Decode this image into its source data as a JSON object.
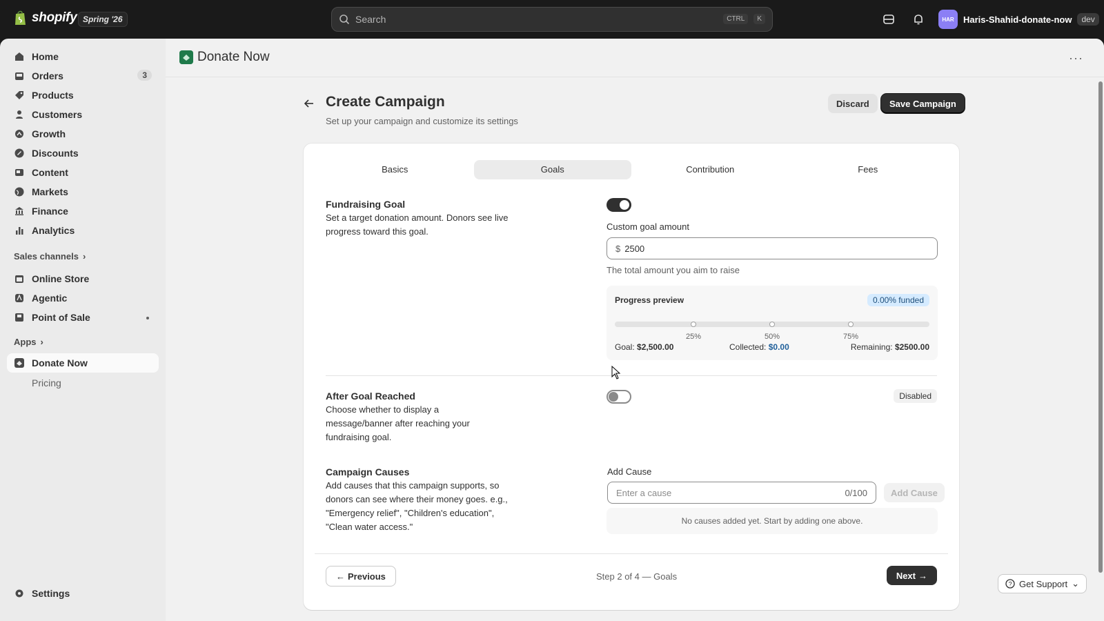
{
  "topbar": {
    "brand": "shopify",
    "edition": "Spring '26",
    "search_placeholder": "Search",
    "shortcut_ctrl": "CTRL",
    "shortcut_key": "K",
    "user_initials": "HAR",
    "user_name": "Haris-Shahid-donate-now",
    "user_badge": "dev"
  },
  "sidebar": {
    "items": [
      {
        "label": "Home",
        "icon": "home-icon"
      },
      {
        "label": "Orders",
        "icon": "orders-icon",
        "count": "3"
      },
      {
        "label": "Products",
        "icon": "products-icon"
      },
      {
        "label": "Customers",
        "icon": "customers-icon"
      },
      {
        "label": "Growth",
        "icon": "growth-icon"
      },
      {
        "label": "Discounts",
        "icon": "discounts-icon"
      },
      {
        "label": "Content",
        "icon": "content-icon"
      },
      {
        "label": "Markets",
        "icon": "markets-icon"
      },
      {
        "label": "Finance",
        "icon": "finance-icon"
      },
      {
        "label": "Analytics",
        "icon": "analytics-icon"
      }
    ],
    "sales_channels_label": "Sales channels",
    "channels": [
      {
        "label": "Online Store",
        "icon": "online-store-icon"
      },
      {
        "label": "Agentic",
        "icon": "agentic-icon"
      },
      {
        "label": "Point of Sale",
        "icon": "pos-icon"
      }
    ],
    "apps_label": "Apps",
    "app_item": "Donate Now",
    "app_sub_item": "Pricing",
    "settings_label": "Settings"
  },
  "app_header": {
    "title": "Donate Now"
  },
  "page": {
    "title": "Create Campaign",
    "subtitle": "Set up your campaign and customize its settings",
    "discard_label": "Discard",
    "save_label": "Save Campaign"
  },
  "tabs": [
    {
      "label": "Basics",
      "active": false
    },
    {
      "label": "Goals",
      "active": true
    },
    {
      "label": "Contribution",
      "active": false
    },
    {
      "label": "Fees",
      "active": false
    }
  ],
  "fundraising": {
    "title": "Fundraising Goal",
    "description": "Set a target donation amount. Donors see live progress toward this goal.",
    "toggle_on": true,
    "field_label": "Custom goal amount",
    "currency_symbol": "$",
    "amount_value": "2500",
    "help_text": "The total amount you aim to raise"
  },
  "progress_preview": {
    "title": "Progress preview",
    "badge": "0.00% funded",
    "funded_fraction": 0,
    "ticks": [
      "25%",
      "50%",
      "75%"
    ],
    "goal_label": "Goal:",
    "goal_value": "$2,500.00",
    "collected_label": "Collected:",
    "collected_value": "$0.00",
    "remaining_label": "Remaining:",
    "remaining_value": "$2500.00"
  },
  "after_goal": {
    "title": "After Goal Reached",
    "description": "Choose whether to display a message/banner after reaching your fundraising goal.",
    "toggle_on": false,
    "status": "Disabled"
  },
  "causes": {
    "title": "Campaign Causes",
    "description": "Add causes that this campaign supports, so donors can see where their money goes. e.g., \"Emergency relief\", \"Children's education\", \"Clean water access.\"",
    "field_label": "Add Cause",
    "input_placeholder": "Enter a cause",
    "char_counter": "0/100",
    "add_button": "Add Cause",
    "empty_text": "No causes added yet. Start by adding one above."
  },
  "footer": {
    "previous_label": "Previous",
    "step_text": "Step 2 of 4 — Goals",
    "next_label": "Next"
  },
  "support": {
    "label": "Get Support"
  },
  "colors": {
    "topbar_bg": "#1a1a1a",
    "sidebar_bg": "#ebebeb",
    "main_bg": "#f1f1f1",
    "primary_button": "#303030",
    "funded_badge_bg": "#d5ebff",
    "app_logo": "#1f7a4a"
  }
}
